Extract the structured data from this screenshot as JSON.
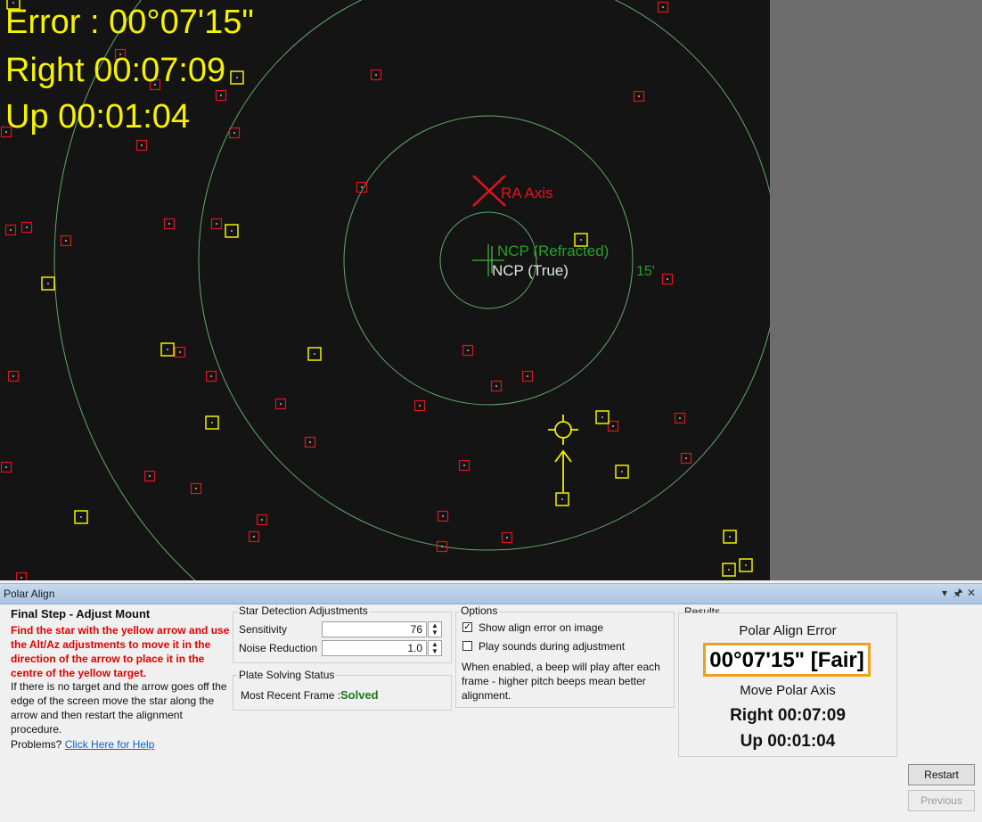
{
  "overlay": {
    "error": "Error : 00°07'15\"",
    "right": "Right 00:07:09",
    "up": "Up 00:01:04"
  },
  "plot_labels": {
    "ra_axis": "RA Axis",
    "ncp_refracted": "NCP (Refracted)",
    "ncp_true": "NCP (True)",
    "ring_label": "15'"
  },
  "colors": {
    "sky": "#141414",
    "ring": "#63a86a",
    "star_box_red": "#e0141e",
    "star_box_yellow": "#f0f000",
    "ra_axis": "#e0141e",
    "ncp_refracted": "#2aa02a",
    "ncp_true": "#d8e8d8",
    "target": "#f0f000",
    "accent": "#f0a020"
  },
  "panel": {
    "title": "Polar Align",
    "controls": {
      "dropdown": "▾",
      "pin": "🖈",
      "close": "✕"
    }
  },
  "instructions": {
    "title": "Final Step - Adjust Mount",
    "warning": "Find the star with the yellow arrow and use the Alt/Az adjustments to move it in the direction of the arrow to place it in the centre of the yellow target.",
    "info": "If there is no target and the arrow goes off the edge of the screen move the star along the arrow and then restart the alignment procedure.",
    "problems_label": "Problems?",
    "help_link": "Click Here for Help"
  },
  "star_detection": {
    "title": "Star Detection Adjustments",
    "sensitivity_label": "Sensitivity",
    "sensitivity_value": "76",
    "noise_label": "Noise Reduction",
    "noise_value": "1.0"
  },
  "plate_solving": {
    "title": "Plate Solving Status",
    "frame_label": "Most Recent Frame :",
    "frame_status": "Solved"
  },
  "options": {
    "title": "Options",
    "show_error_label": "Show align error on image",
    "show_error_checked": true,
    "play_sounds_label": "Play sounds during adjustment",
    "play_sounds_checked": false,
    "note": "When enabled, a beep will play after each frame - higher pitch beeps mean better alignment."
  },
  "results": {
    "title": "Results",
    "error_heading": "Polar Align Error",
    "error_value": "00°07'15\" [Fair]",
    "move_heading": "Move Polar Axis",
    "right": "Right 00:07:09",
    "up": "Up 00:01:04"
  },
  "buttons": {
    "restart": "Restart",
    "previous": "Previous"
  }
}
